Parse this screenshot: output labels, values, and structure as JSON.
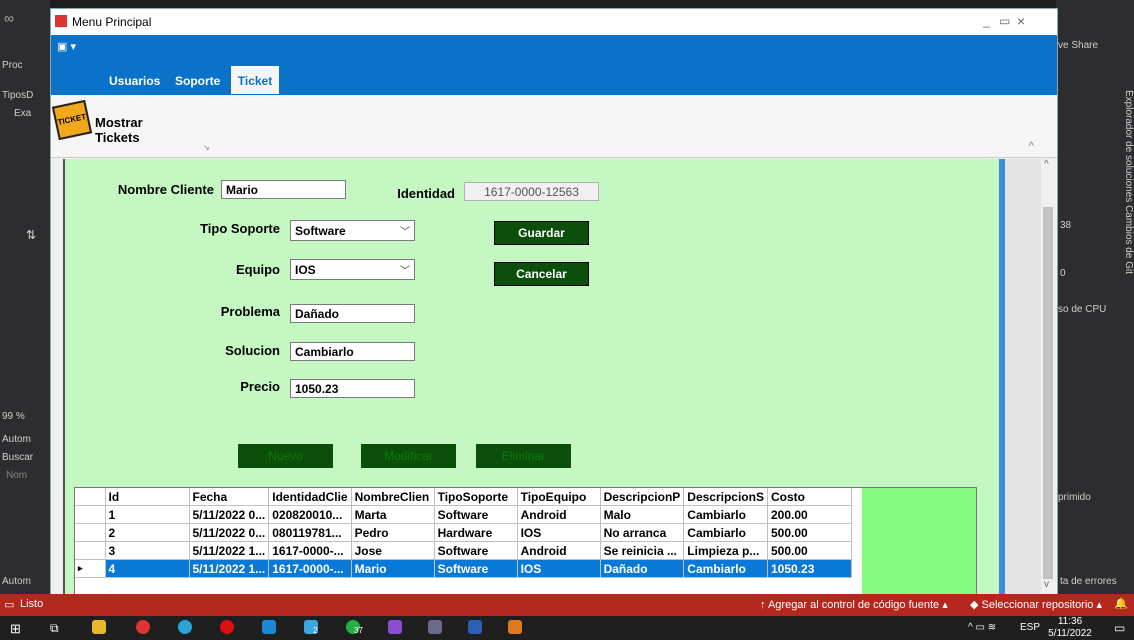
{
  "window": {
    "title": "Menu Principal",
    "controls": [
      "_",
      "▭",
      "×"
    ]
  },
  "tabs": [
    {
      "label": "Usuarios"
    },
    {
      "label": "Soporte"
    },
    {
      "label": "Ticket"
    }
  ],
  "ribbon": {
    "button_label": "Mostrar Tickets",
    "icon_text": "TICKET"
  },
  "form": {
    "nombre_cliente_label": "Nombre Cliente",
    "nombre_cliente_value": "Mario",
    "identidad_label": "Identidad",
    "identidad_value": "1617-0000-12563",
    "tipo_soporte_label": "Tipo Soporte",
    "tipo_soporte_value": "Software",
    "equipo_label": "Equipo",
    "equipo_value": "IOS",
    "problema_label": "Problema",
    "problema_value": "Dañado",
    "solucion_label": "Solucion",
    "solucion_value": "Cambiarlo",
    "precio_label": "Precio",
    "precio_value": "1050.23",
    "guardar": "Guardar",
    "cancelar": "Cancelar",
    "nuevo": "Nuevo",
    "modificar": "Modificar",
    "eliminar": "Eliminar"
  },
  "grid": {
    "headers": [
      "Id",
      "Fecha",
      "IdentidadClie",
      "NombreClien",
      "TipoSoporte",
      "TipoEquipo",
      "DescripcionP",
      "DescripcionS",
      "Costo"
    ],
    "rows": [
      [
        "1",
        "5/11/2022 0...",
        "020820010...",
        "Marta",
        "Software",
        "Android",
        "Malo",
        "Cambiarlo",
        "200.00"
      ],
      [
        "2",
        "5/11/2022 0...",
        "080119781...",
        "Pedro",
        "Hardware",
        "IOS",
        "No arranca",
        "Cambiarlo",
        "500.00"
      ],
      [
        "3",
        "5/11/2022 1...",
        "1617-0000-...",
        "Jose",
        "Software",
        "Android",
        "Se reinicia ...",
        "Limpieza p...",
        "500.00"
      ],
      [
        "4",
        "5/11/2022 1...",
        "1617-0000-...",
        "Mario",
        "Software",
        "IOS",
        "Dañado",
        "Cambiarlo",
        "1050.23"
      ]
    ],
    "selected_row_marker": "▸"
  },
  "vs": {
    "left_labels": [
      "Proc",
      "TiposD",
      "Exa",
      "99 %",
      "Autom",
      "Buscar",
      "Nom",
      "Autom"
    ],
    "right_labels": [
      "ve Share",
      "38",
      "0",
      "so de CPU",
      "primido",
      "ta de errores"
    ],
    "side_tabs": "Explorador de soluciones   Cambios de Git",
    "status_left": "Listo",
    "status_add": "Agregar al control de código fuente",
    "status_repo": "Seleccionar repositorio",
    "taskbar": {
      "lang": "ESP",
      "time": "11:36",
      "date": "5/11/2022",
      "badge1": "2",
      "badge2": "37"
    }
  }
}
